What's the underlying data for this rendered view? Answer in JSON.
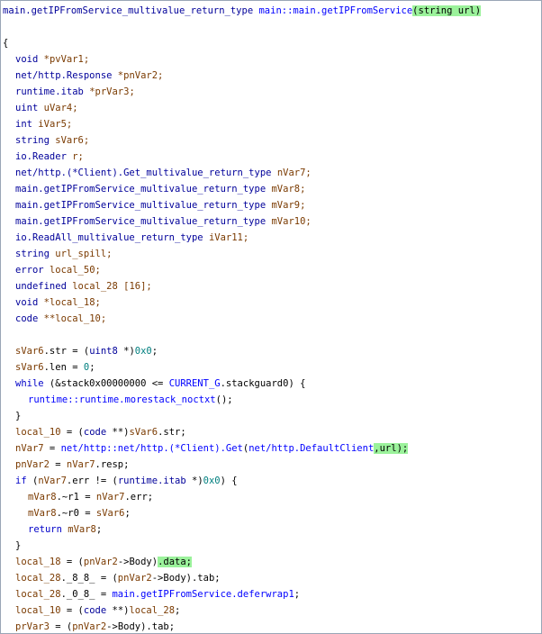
{
  "signature": {
    "ret_type": "main.getIPFromService_multivalue_return_type",
    "fn_name": "main::main.getIPFromService",
    "params": "(string url)"
  },
  "open_brace": "{",
  "decls": [
    {
      "type": "void",
      "name": "*pvVar1;"
    },
    {
      "type": "net/http.Response",
      "name": "*pnVar2;"
    },
    {
      "type": "runtime.itab",
      "name": "*prVar3;"
    },
    {
      "type": "uint",
      "name": "uVar4;"
    },
    {
      "type": "int",
      "name": "iVar5;"
    },
    {
      "type": "string",
      "name": "sVar6;"
    },
    {
      "type": "io.Reader",
      "name": "r;"
    },
    {
      "type": "net/http.(*Client).Get_multivalue_return_type",
      "name": "nVar7;"
    },
    {
      "type": "main.getIPFromService_multivalue_return_type",
      "name": "mVar8;"
    },
    {
      "type": "main.getIPFromService_multivalue_return_type",
      "name": "mVar9;"
    },
    {
      "type": "main.getIPFromService_multivalue_return_type",
      "name": "mVar10;"
    },
    {
      "type": "io.ReadAll_multivalue_return_type",
      "name": "iVar11;"
    },
    {
      "type": "string",
      "name": "url_spill;"
    },
    {
      "type": "error",
      "name": "local_50;"
    },
    {
      "type": "undefined",
      "name": "local_28 [16];"
    },
    {
      "type": "void",
      "name": "*local_18;"
    },
    {
      "type": "code",
      "name": "**local_10;"
    }
  ],
  "body": {
    "l1": {
      "a": "sVar6",
      "b": ".str = (",
      "c": "uint8",
      "d": " *)",
      "e": "0x0",
      "f": ";"
    },
    "l2": {
      "a": "sVar6",
      "b": ".len = ",
      "c": "0",
      "d": ";"
    },
    "l3": {
      "a": "while",
      "b": " (&stack0x00000000 <= ",
      "c": "CURRENT_G",
      "d": ".stackguard0) {"
    },
    "l4": {
      "a": "runtime::runtime.morestack_noctxt",
      "b": "();"
    },
    "l5": {
      "a": "}"
    },
    "l6": {
      "a": "local_10",
      "b": " = (",
      "c": "code",
      "d": " **)",
      "e": "sVar6",
      "f": ".str;"
    },
    "l7": {
      "a": "nVar7",
      "b": " = ",
      "c": "net/http::net/http.(*Client).Get",
      "d": "(",
      "e": "net/http.DefaultClient",
      "f": ",url);"
    },
    "l8": {
      "a": "pnVar2",
      "b": " = ",
      "c": "nVar7",
      "d": ".resp;"
    },
    "l9": {
      "a": "if",
      "b": " (",
      "c": "nVar7",
      "d": ".err != (",
      "e": "runtime.itab",
      "f": " *)",
      "g": "0x0",
      "h": ") {"
    },
    "l10": {
      "a": "mVar8",
      "b": ".~r1 = ",
      "c": "nVar7",
      "d": ".err;"
    },
    "l11": {
      "a": "mVar8",
      "b": ".~r0 = ",
      "c": "sVar6",
      "d": ";"
    },
    "l12": {
      "a": "return",
      "b": " ",
      "c": "mVar8",
      "d": ";"
    },
    "l13": {
      "a": "}"
    },
    "l14": {
      "a": "local_18",
      "b": " = (",
      "c": "pnVar2",
      "d": "->Body)",
      "e": ".data;"
    },
    "l15": {
      "a": "local_28",
      "b": "._8_8_ = (",
      "c": "pnVar2",
      "d": "->Body).tab;"
    },
    "l16": {
      "a": "local_28",
      "b": "._0_8_ = ",
      "c": "main.getIPFromService.deferwrap1",
      "d": ";"
    },
    "l17": {
      "a": "local_10",
      "b": " = (",
      "c": "code",
      "d": " **)",
      "e": "local_28",
      "f": ";"
    },
    "l18": {
      "a": "prVar3",
      "b": " = (",
      "c": "pnVar2",
      "d": "->Body).tab;"
    }
  },
  "colors": {
    "type": "#00009a",
    "function": "#0000ff",
    "variable": "#7a3a00",
    "keyword": "#0000c8",
    "number": "#007f7f",
    "highlight": "#9bf29b"
  }
}
